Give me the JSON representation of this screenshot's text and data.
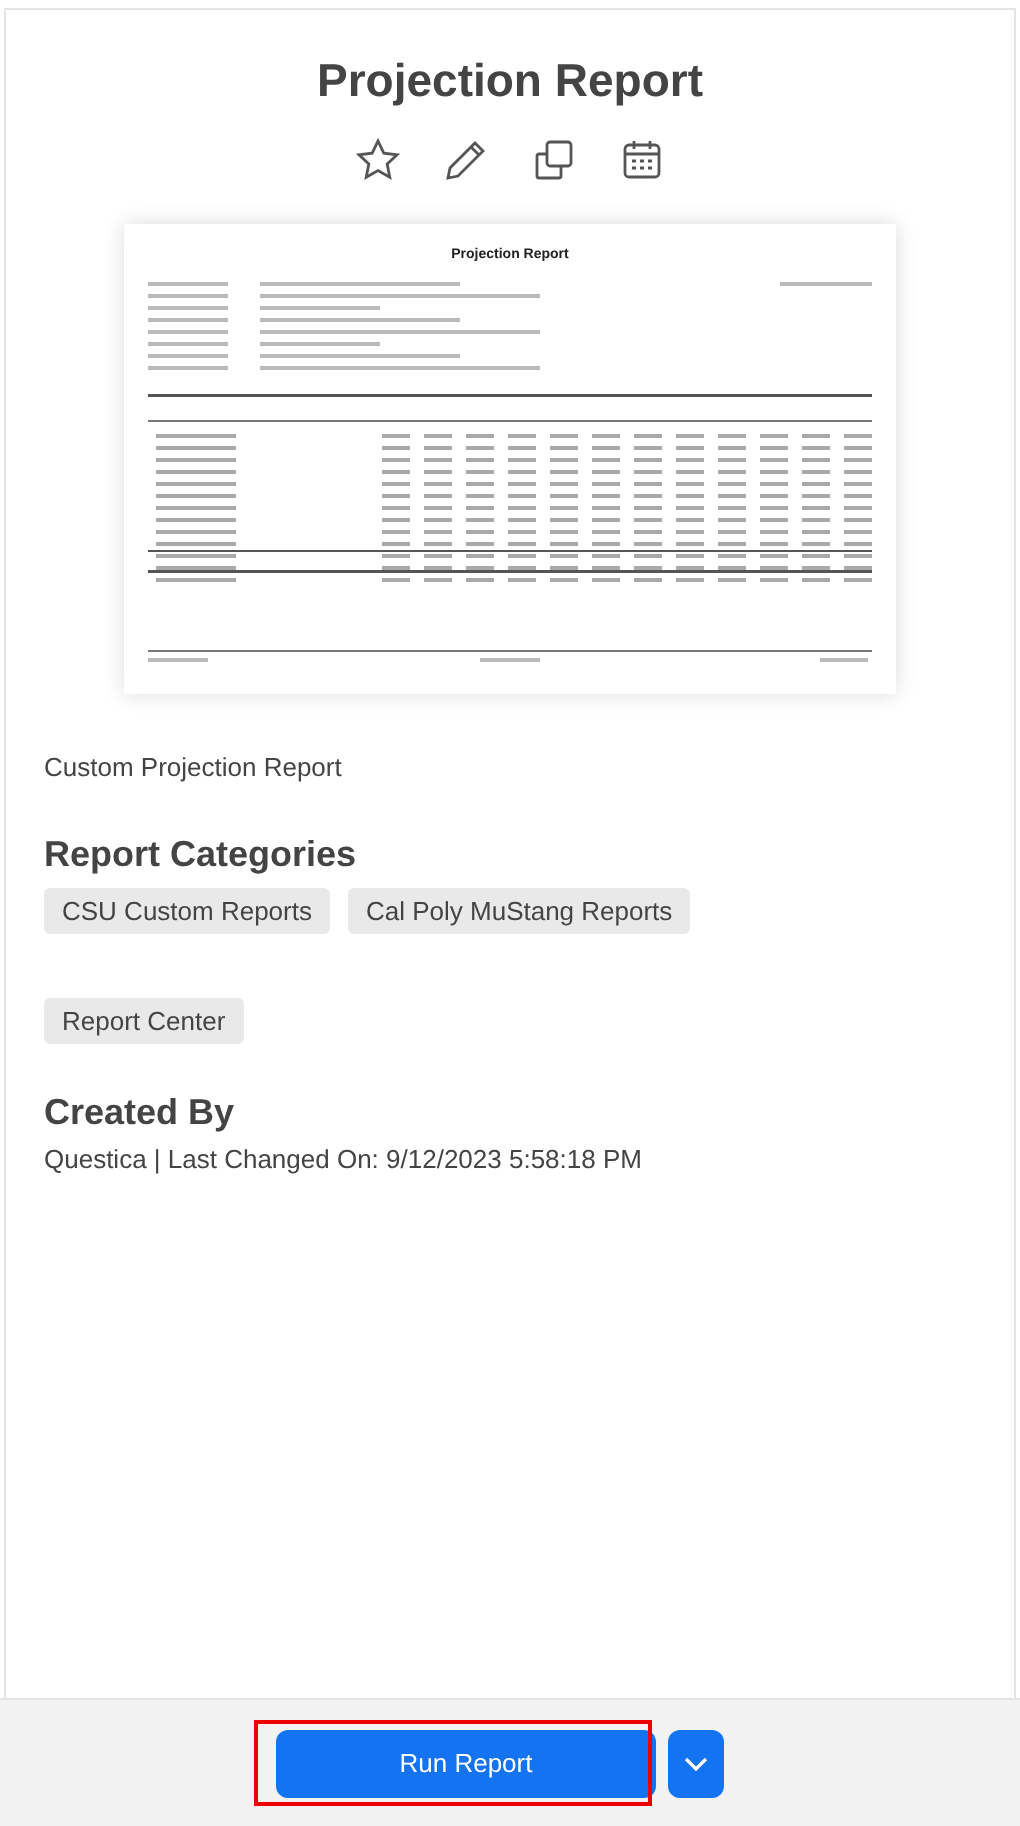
{
  "title": "Projection Report",
  "actions": [
    {
      "kind": "star"
    },
    {
      "kind": "edit"
    },
    {
      "kind": "copy"
    },
    {
      "kind": "schedule"
    }
  ],
  "preview": {
    "title": "Projection Report"
  },
  "description": "Custom Projection Report",
  "categories": {
    "heading": "Report Categories",
    "tags": [
      {
        "label": "CSU Custom Reports"
      },
      {
        "label": "Cal Poly MuStang Reports"
      }
    ],
    "extra_tags": [
      {
        "label": "Report Center"
      }
    ]
  },
  "created_by": {
    "heading": "Created By",
    "text": "Questica | Last Changed On: 9/12/2023 5:58:18 PM"
  },
  "footer": {
    "run_button": {
      "label": "Run Report",
      "highlighted": true
    }
  }
}
